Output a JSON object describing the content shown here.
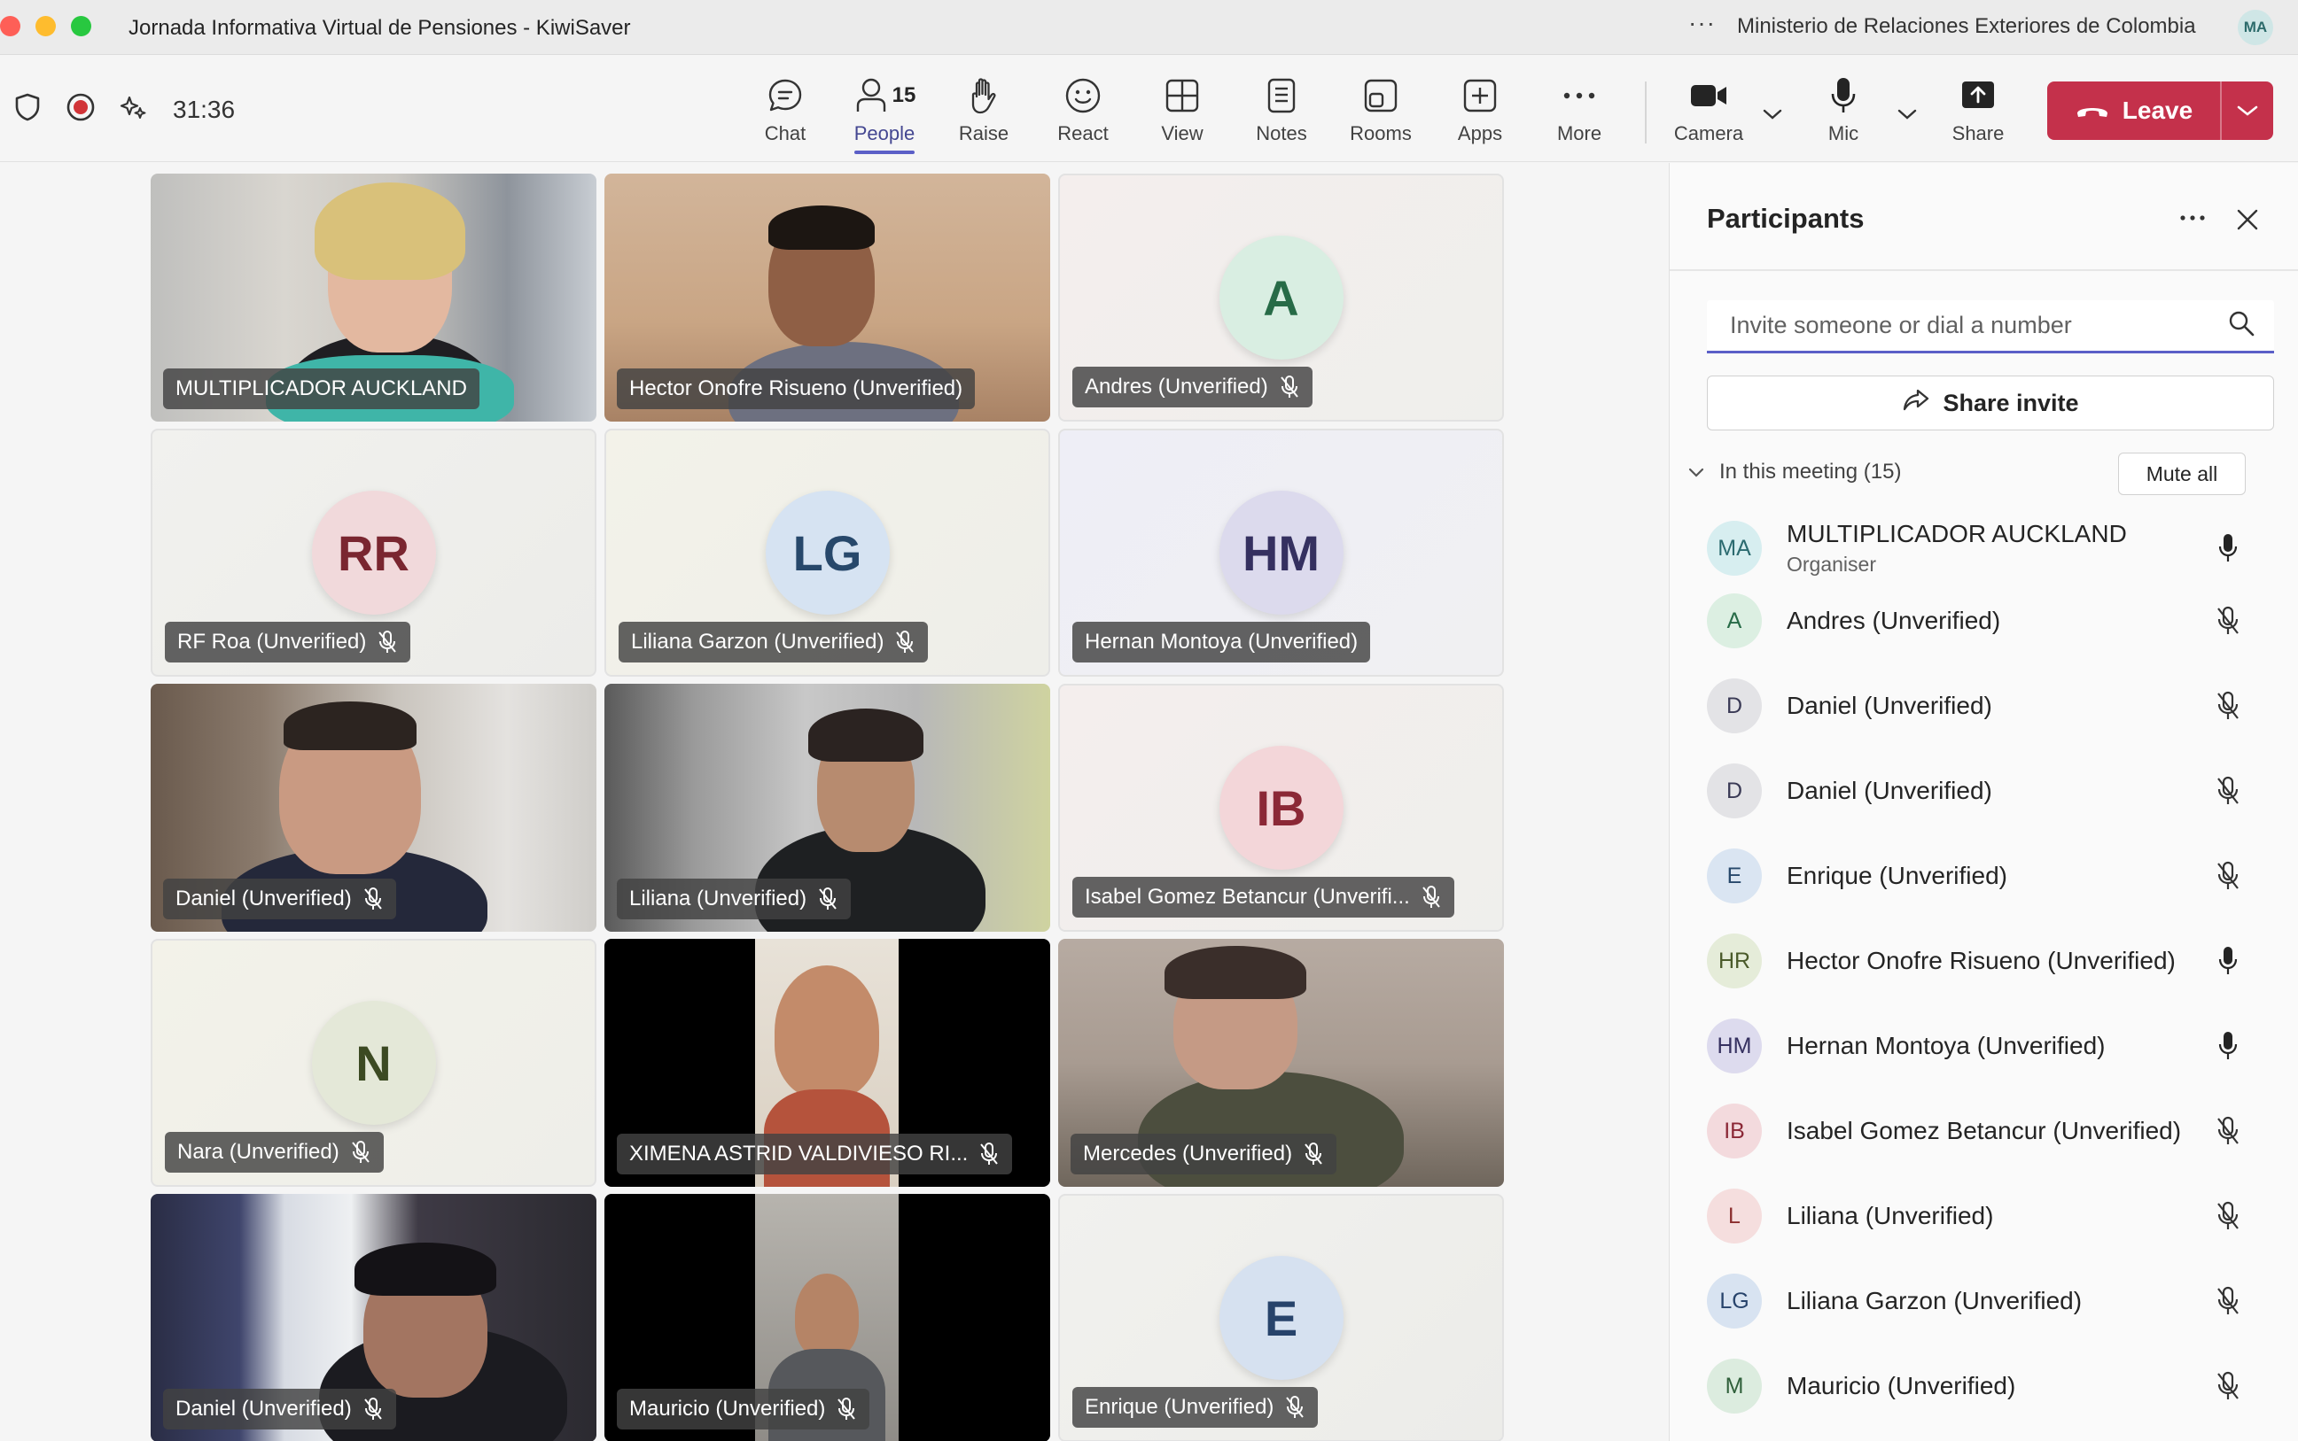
{
  "window": {
    "title": "Jornada Informativa Virtual de Pensiones - KiwiSaver",
    "org": "Ministerio de Relaciones Exteriores de Colombia",
    "user_initials": "MA"
  },
  "toolbar": {
    "timer": "31:36",
    "people_count": "15",
    "items": {
      "chat": "Chat",
      "people": "People",
      "raise": "Raise",
      "react": "React",
      "view": "View",
      "notes": "Notes",
      "rooms": "Rooms",
      "apps": "Apps",
      "more": "More",
      "camera": "Camera",
      "mic": "Mic",
      "share": "Share"
    },
    "leave_label": "Leave"
  },
  "tiles": [
    {
      "name": "MULTIPLICADOR AUCKLAND",
      "muted": false,
      "kind": "video"
    },
    {
      "name": "Hector Onofre Risueno (Unverified)",
      "muted": false,
      "kind": "video"
    },
    {
      "name": "Andres (Unverified)",
      "muted": true,
      "kind": "avatar",
      "initials": "A"
    },
    {
      "name": "RF Roa (Unverified)",
      "muted": true,
      "kind": "avatar",
      "initials": "RR"
    },
    {
      "name": "Liliana Garzon (Unverified)",
      "muted": true,
      "kind": "avatar",
      "initials": "LG"
    },
    {
      "name": "Hernan Montoya (Unverified)",
      "muted": false,
      "kind": "avatar",
      "initials": "HM"
    },
    {
      "name": "Daniel (Unverified)",
      "muted": true,
      "kind": "video"
    },
    {
      "name": "Liliana (Unverified)",
      "muted": true,
      "kind": "video"
    },
    {
      "name": "Isabel Gomez Betancur (Unverifi...",
      "muted": true,
      "kind": "avatar",
      "initials": "IB"
    },
    {
      "name": "Nara (Unverified)",
      "muted": true,
      "kind": "avatar",
      "initials": "N"
    },
    {
      "name": "XIMENA ASTRID VALDIVIESO RI...",
      "muted": true,
      "kind": "video"
    },
    {
      "name": "Mercedes (Unverified)",
      "muted": true,
      "kind": "video"
    },
    {
      "name": "Daniel (Unverified)",
      "muted": true,
      "kind": "video"
    },
    {
      "name": "Mauricio (Unverified)",
      "muted": true,
      "kind": "video"
    },
    {
      "name": "Enrique (Unverified)",
      "muted": true,
      "kind": "avatar",
      "initials": "E"
    }
  ],
  "panel": {
    "title": "Participants",
    "invite_placeholder": "Invite someone or dial a number",
    "share_invite": "Share invite",
    "section": "In this meeting (15)",
    "mute_all": "Mute all",
    "participants": [
      {
        "initials": "MA",
        "name": "MULTIPLICADOR AUCKLAND",
        "role": "Organiser",
        "muted": false
      },
      {
        "initials": "A",
        "name": "Andres (Unverified)",
        "muted": true
      },
      {
        "initials": "D",
        "name": "Daniel (Unverified)",
        "muted": true
      },
      {
        "initials": "D",
        "name": "Daniel (Unverified)",
        "muted": true
      },
      {
        "initials": "E",
        "name": "Enrique (Unverified)",
        "muted": true
      },
      {
        "initials": "HR",
        "name": "Hector Onofre Risueno (Unverified)",
        "muted": false
      },
      {
        "initials": "HM",
        "name": "Hernan Montoya (Unverified)",
        "muted": false
      },
      {
        "initials": "IB",
        "name": "Isabel Gomez Betancur (Unverified)",
        "muted": true
      },
      {
        "initials": "L",
        "name": "Liliana (Unverified)",
        "muted": true
      },
      {
        "initials": "LG",
        "name": "Liliana Garzon (Unverified)",
        "muted": true
      },
      {
        "initials": "M",
        "name": "Mauricio (Unverified)",
        "muted": true
      }
    ]
  },
  "colors": {
    "accent": "#5b5fc7",
    "leave": "#c4314b"
  }
}
